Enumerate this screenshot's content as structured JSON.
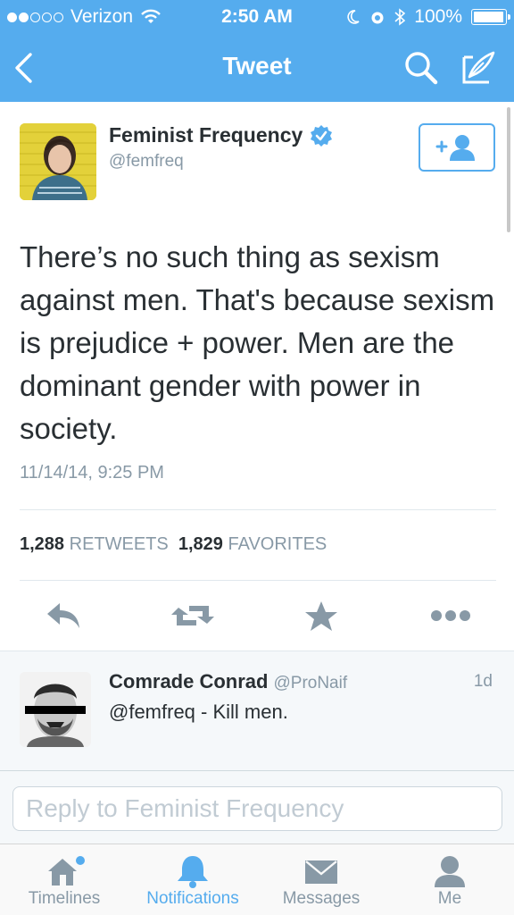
{
  "status_bar": {
    "carrier": "Verizon",
    "time": "2:50 AM",
    "battery": "100%"
  },
  "nav": {
    "title": "Tweet",
    "icons": [
      "back-chevron-icon",
      "search-icon",
      "compose-icon"
    ]
  },
  "tweet": {
    "author_name": "Feminist Frequency",
    "author_handle": "@femfreq",
    "verified": true,
    "text": "There’s no such thing as sexism against men. That's because sexism is prejudice + power. Men are the dominant gender with power in society.",
    "timestamp": "11/14/14, 9:25 PM",
    "retweet_count": "1,288",
    "retweet_label": "RETWEETS",
    "favorite_count": "1,829",
    "favorite_label": "FAVORITES"
  },
  "reply": {
    "author_name": "Comrade Conrad",
    "author_handle": "@ProNaif",
    "age": "1d",
    "text": "@femfreq - Kill men."
  },
  "reply_box": {
    "placeholder": "Reply to Feminist Frequency"
  },
  "tabs": [
    {
      "label": "Timelines",
      "icon": "home-icon",
      "active": false
    },
    {
      "label": "Notifications",
      "icon": "bell-icon",
      "active": true
    },
    {
      "label": "Messages",
      "icon": "envelope-icon",
      "active": false
    },
    {
      "label": "Me",
      "icon": "person-icon",
      "active": false
    }
  ],
  "colors": {
    "accent": "#55acee",
    "text": "#292f33",
    "muted": "#8899a6"
  }
}
